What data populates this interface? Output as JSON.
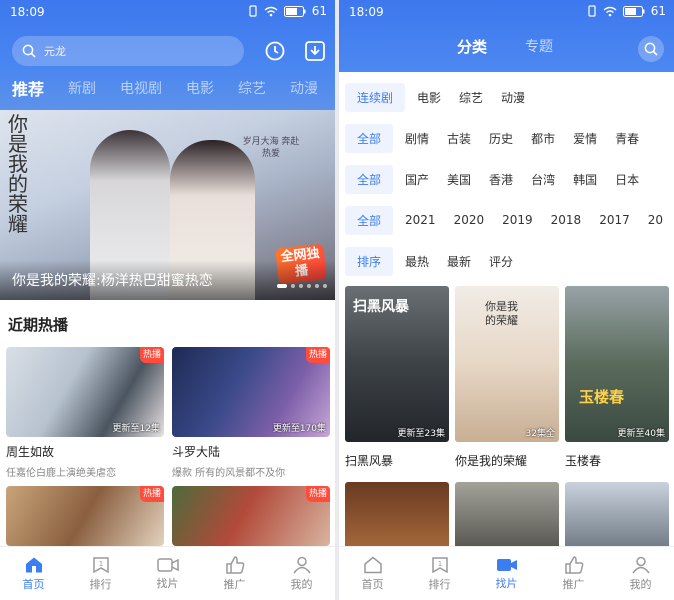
{
  "status": {
    "time": "18:09",
    "battery": "61"
  },
  "left": {
    "search": {
      "placeholder": "元龙"
    },
    "tabs": [
      {
        "label": "推荐",
        "active": true
      },
      {
        "label": "新剧"
      },
      {
        "label": "电视剧"
      },
      {
        "label": "电影"
      },
      {
        "label": "综艺"
      },
      {
        "label": "动漫"
      }
    ],
    "banner": {
      "title": "你是我的荣耀:杨洋热巴甜蜜热恋",
      "calligraphy": "你是我的荣耀",
      "logo_text": "岁月大海 奔赴热爱",
      "badge": "全网独播"
    },
    "section_title": "近期热播",
    "cards": [
      {
        "name": "周生如故",
        "desc": "任嘉伦白鹿上演绝美虐恋",
        "episodes": "更新至12集",
        "hot": "热播"
      },
      {
        "name": "斗罗大陆",
        "desc": "爆款 所有的风景都不及你",
        "episodes": "更新至170集",
        "hot": "热播"
      },
      {
        "name": "",
        "desc": "",
        "episodes": "",
        "hot": "热播"
      },
      {
        "name": "",
        "desc": "",
        "episodes": "",
        "hot": "热播"
      }
    ],
    "bottom_nav": [
      {
        "label": "首页",
        "icon": "home-icon",
        "active": true
      },
      {
        "label": "排行",
        "icon": "rank-icon"
      },
      {
        "label": "找片",
        "icon": "video-icon"
      },
      {
        "label": "推广",
        "icon": "thumb-icon"
      },
      {
        "label": "我的",
        "icon": "user-icon"
      }
    ]
  },
  "right": {
    "segments": [
      {
        "label": "分类",
        "active": true
      },
      {
        "label": "专题"
      }
    ],
    "type_row": {
      "selected": "连续剧",
      "options": [
        "电影",
        "综艺",
        "动漫"
      ]
    },
    "genre_row": {
      "label": "全部",
      "options": [
        "剧情",
        "古装",
        "历史",
        "都市",
        "爱情",
        "青春"
      ]
    },
    "region_row": {
      "label": "全部",
      "options": [
        "国产",
        "美国",
        "香港",
        "台湾",
        "韩国",
        "日本"
      ]
    },
    "year_row": {
      "label": "全部",
      "options": [
        "2021",
        "2020",
        "2019",
        "2018",
        "2017",
        "20"
      ]
    },
    "sort_row": {
      "label": "排序",
      "options": [
        "最热",
        "最新",
        "评分"
      ]
    },
    "posters": [
      {
        "name": "扫黑风暴",
        "episodes": "更新至23集",
        "title_art": "扫黑风暴"
      },
      {
        "name": "你是我的荣耀",
        "episodes": "32集全",
        "title_art": "你是我的荣耀"
      },
      {
        "name": "玉楼春",
        "episodes": "更新至40集",
        "title_art": "玉楼春"
      }
    ],
    "bottom_nav": [
      {
        "label": "首页",
        "icon": "home-icon"
      },
      {
        "label": "排行",
        "icon": "rank-icon"
      },
      {
        "label": "找片",
        "icon": "video-icon",
        "active": true
      },
      {
        "label": "推广",
        "icon": "thumb-icon"
      },
      {
        "label": "我的",
        "icon": "user-icon"
      }
    ]
  },
  "colors": {
    "accent": "#3c7ef1",
    "header": "#3d78ee",
    "hot": "#ff4d3d"
  }
}
